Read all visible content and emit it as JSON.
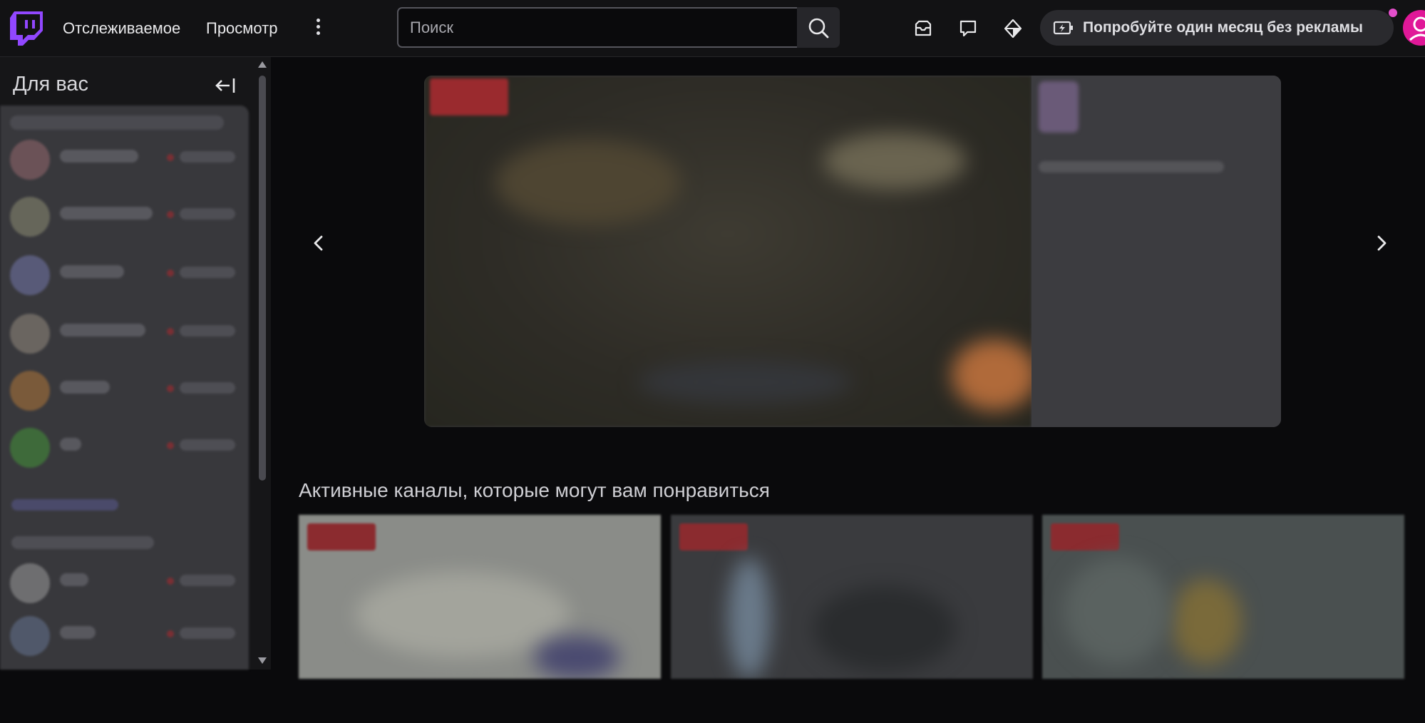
{
  "topbar": {
    "nav": {
      "following": "Отслеживаемое",
      "browse": "Просмотр"
    },
    "search": {
      "placeholder": "Поиск"
    },
    "promo_label": "Попробуйте один месяц без рекламы",
    "icons": [
      "twitch-logo-icon",
      "more-vertical-icon",
      "search-icon",
      "inbox-icon",
      "whispers-icon",
      "prime-crown-icon",
      "ad-free-battery-icon",
      "user-avatar-icon"
    ]
  },
  "sidebar": {
    "title": "Для вас",
    "collapse_icon": "collapse-left-icon"
  },
  "main": {
    "section_title": "Активные каналы, которые могут вам понравиться",
    "carousel_icons": [
      "chevron-left-icon",
      "chevron-right-icon"
    ]
  },
  "colors": {
    "brand": "#9147ff",
    "accent_pink": "#e01898",
    "background": "#0a0a0c",
    "topbar": "#121214",
    "live_red": "#eb0400"
  }
}
